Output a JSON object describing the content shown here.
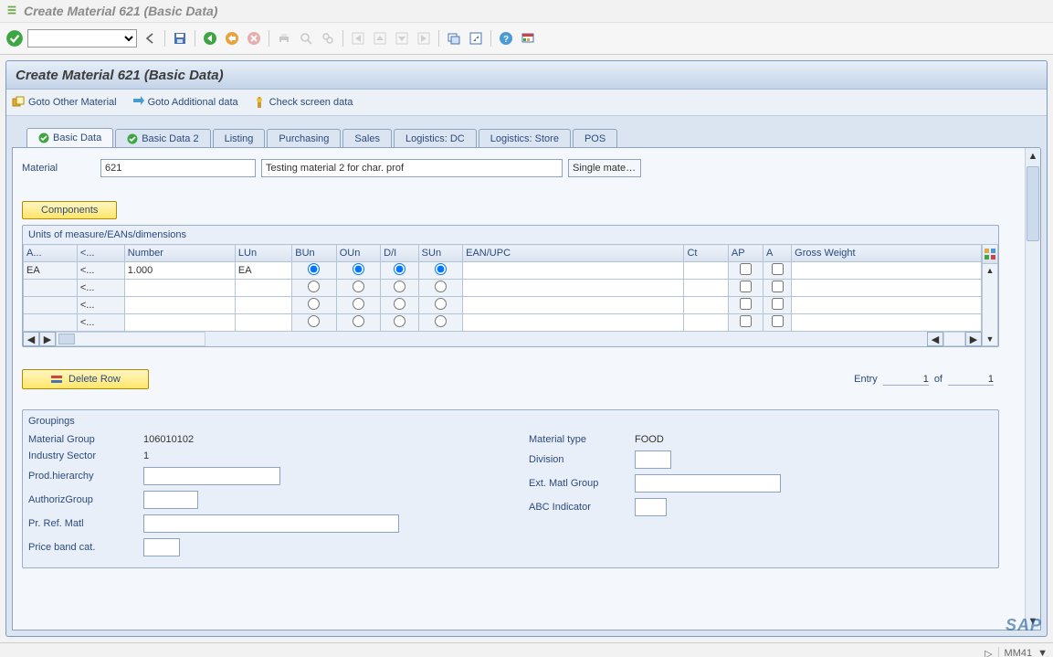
{
  "window": {
    "title": "Create Material 621 (Basic Data)"
  },
  "panel": {
    "header": "Create Material 621 (Basic Data)"
  },
  "appToolbar": {
    "gotoOther": "Goto Other Material",
    "gotoAdditional": "Goto Additional data",
    "checkScreen": "Check screen data"
  },
  "tabs": [
    {
      "key": "basic-data",
      "label": "Basic Data",
      "checked": true,
      "active": true
    },
    {
      "key": "basic-data-2",
      "label": "Basic Data 2",
      "checked": true,
      "active": false
    },
    {
      "key": "listing",
      "label": "Listing",
      "checked": false,
      "active": false
    },
    {
      "key": "purchasing",
      "label": "Purchasing",
      "checked": false,
      "active": false
    },
    {
      "key": "sales",
      "label": "Sales",
      "checked": false,
      "active": false
    },
    {
      "key": "logistics-dc",
      "label": "Logistics: DC",
      "checked": false,
      "active": false
    },
    {
      "key": "logistics-store",
      "label": "Logistics: Store",
      "checked": false,
      "active": false
    },
    {
      "key": "pos",
      "label": "POS",
      "checked": false,
      "active": false
    }
  ],
  "material": {
    "label": "Material",
    "number": "621",
    "description": "Testing material 2 for char. prof",
    "category": "Single mate…"
  },
  "buttons": {
    "components": "Components",
    "deleteRow": "Delete Row"
  },
  "uom": {
    "title": "Units of measure/EANs/dimensions",
    "columns": {
      "aun": "A...",
      "qty": "<...",
      "number": "Number",
      "lun": "LUn",
      "bun": "BUn",
      "oun": "OUn",
      "di": "D/I",
      "sun": "SUn",
      "ean": "EAN/UPC",
      "ct": "Ct",
      "ap": "AP",
      "a": "A",
      "gross": "Gross Weight"
    },
    "rows": [
      {
        "aun": "EA",
        "qty": "<...",
        "number": "1.000",
        "lun": "EA",
        "bun": true,
        "oun": true,
        "di": true,
        "sun": true,
        "ean": "",
        "ct": "",
        "ap": false,
        "a": false,
        "gross": ""
      },
      {
        "aun": "",
        "qty": "<...",
        "number": "",
        "lun": "",
        "bun": null,
        "oun": null,
        "di": null,
        "sun": null,
        "ean": "",
        "ct": "",
        "ap": false,
        "a": false,
        "gross": ""
      },
      {
        "aun": "",
        "qty": "<...",
        "number": "",
        "lun": "",
        "bun": null,
        "oun": null,
        "di": null,
        "sun": null,
        "ean": "",
        "ct": "",
        "ap": false,
        "a": false,
        "gross": ""
      },
      {
        "aun": "",
        "qty": "<...",
        "number": "",
        "lun": "",
        "bun": null,
        "oun": null,
        "di": null,
        "sun": null,
        "ean": "",
        "ct": "",
        "ap": false,
        "a": false,
        "gross": ""
      }
    ]
  },
  "entry": {
    "label": "Entry",
    "current": "1",
    "of": "of",
    "total": "1"
  },
  "groupings": {
    "title": "Groupings",
    "materialGroup": {
      "label": "Material Group",
      "value": "106010102"
    },
    "industrySector": {
      "label": "Industry Sector",
      "value": "1"
    },
    "prodHierarchy": {
      "label": "Prod.hierarchy",
      "value": ""
    },
    "authorizGroup": {
      "label": "AuthorizGroup",
      "value": ""
    },
    "prRefMatl": {
      "label": "Pr. Ref. Matl",
      "value": ""
    },
    "priceBandCat": {
      "label": "Price band cat.",
      "value": ""
    },
    "materialType": {
      "label": "Material type",
      "value": "FOOD"
    },
    "division": {
      "label": "Division",
      "value": ""
    },
    "extMatlGroup": {
      "label": "Ext. Matl Group",
      "value": ""
    },
    "abcIndicator": {
      "label": "ABC Indicator",
      "value": ""
    }
  },
  "statusbar": {
    "txcode": "MM41"
  }
}
